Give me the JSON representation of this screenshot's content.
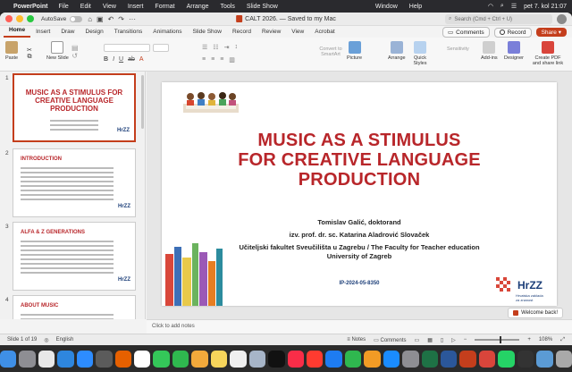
{
  "menubar": {
    "app": "PowerPoint",
    "items": [
      "File",
      "Edit",
      "View",
      "Insert",
      "Format",
      "Arrange",
      "Tools",
      "Slide Show",
      "Window",
      "Help"
    ],
    "clock": "pet 7. kol 21:07"
  },
  "titlebar": {
    "autosave_label": "AutoSave",
    "autosave_state": "OFF",
    "doc_title": "CALT 2026. — Saved to my Mac",
    "search_placeholder": "Search (Cmd + Ctrl + U)"
  },
  "ribbon": {
    "tabs": [
      "Home",
      "Insert",
      "Draw",
      "Design",
      "Transitions",
      "Animations",
      "Slide Show",
      "Record",
      "Review",
      "View",
      "Acrobat"
    ],
    "active_tab": "Home",
    "comments_label": "Comments",
    "record_label": "Record",
    "share_label": "Share",
    "paste_label": "Paste",
    "new_slide_label": "New Slide",
    "convert_label": "Convert to SmartArt",
    "picture_label": "Picture",
    "arrange_label": "Arrange",
    "quick_styles_label": "Quick Styles",
    "sensitivity_label": "Sensitivity",
    "addins_label": "Add-ins",
    "designer_label": "Designer",
    "create_pdf_label": "Create PDF and share link"
  },
  "thumbnails": [
    {
      "num": "1",
      "title": "MUSIC AS A STIMULUS FOR CREATIVE LANGUAGE PRODUCTION"
    },
    {
      "num": "2",
      "title": "INTRODUCTION"
    },
    {
      "num": "3",
      "title": "ALFA & Z GENERATIONS"
    },
    {
      "num": "4",
      "title": "ABOUT MUSIC"
    }
  ],
  "slide": {
    "title_line1": "MUSIC AS A STIMULUS",
    "title_line2": "FOR CREATIVE LANGUAGE",
    "title_line3": "PRODUCTION",
    "author": "Tomislav Galić, doktorand",
    "rank": "izv. prof. dr. sc. Katarina Aladrović Slovaček",
    "institution_line1": "Učiteljski fakultet Sveučilišta u Zagrebu / The Faculty for Teacher education",
    "institution_line2": "University of Zagreb",
    "project_code": "IP-2024-05-8350",
    "logo_text": "HrZZ",
    "logo_sub": "Hrvatska zaklada za znanost"
  },
  "welcome_label": "Welcome back!",
  "notes_placeholder": "Click to add notes",
  "status": {
    "slide_info": "Slide 1 of 19",
    "language": "English",
    "notes_label": "Notes",
    "comments_label": "Comments",
    "zoom": "108%"
  },
  "colors": {
    "accent": "#c43e1c",
    "title_red": "#b8262a",
    "hrzz_blue": "#1d3f79"
  }
}
